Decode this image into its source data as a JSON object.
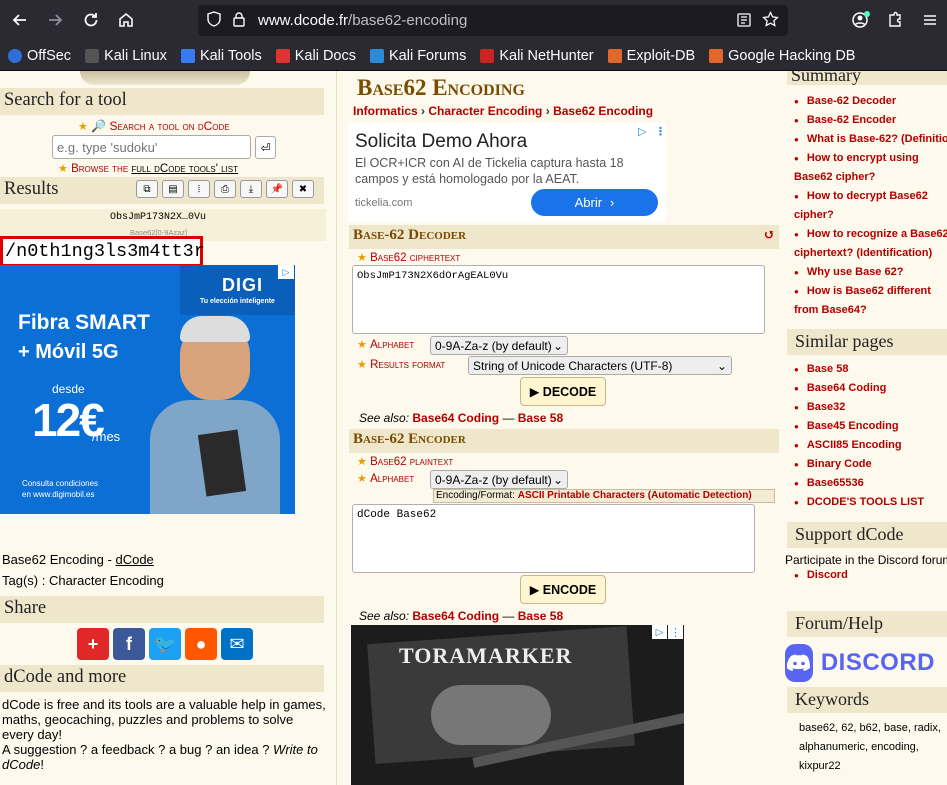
{
  "browser": {
    "url_host": "www.dcode.fr",
    "url_path": "/base62-encoding",
    "bookmarks": [
      "OffSec",
      "Kali Linux",
      "Kali Tools",
      "Kali Docs",
      "Kali Forums",
      "Kali NetHunter",
      "Exploit-DB",
      "Google Hacking DB"
    ]
  },
  "left": {
    "search_title": "Search for a tool",
    "search_link": "Search a tool on dCode",
    "search_placeholder": "e.g. type 'sudoku'",
    "browse_prefix": "Browse the ",
    "browse_link": "full dCode tools' list",
    "results_title": "Results",
    "result_preview": "ObsJmP173N2X…0Vu",
    "result_label": "Base62[0-9Azaz]",
    "result_value": "/n0th1ng3ls3m4tt3r",
    "ad_brand": "DIGI",
    "ad_tagline": "Tu elección inteligente",
    "ad_line1": "Fibra SMART",
    "ad_line2": "+ Móvil 5G",
    "ad_desde": "desde",
    "ad_price": "12€",
    "ad_per": "/mes",
    "ad_footer1": "Consulta condiciones",
    "ad_footer2": "en www.digimobil.es",
    "page_name": "Base62 Encoding - ",
    "page_name_link": "dCode",
    "tags": "Tag(s) : Character Encoding",
    "share_title": "Share",
    "more_title": "dCode and more",
    "more_text": "dCode is free and its tools are a valuable help in games, maths, geocaching, puzzles and problems to solve every day!",
    "suggest_text": "A suggestion ? a feedback ? a bug ? an idea ? ",
    "suggest_link": "Write to dCode",
    "suggest_end": "!"
  },
  "center": {
    "title": "Base62 Encoding",
    "breadcrumb": [
      "Informatics",
      "Character Encoding",
      "Base62 Encoding"
    ],
    "ad_title": "Solicita Demo Ahora",
    "ad_text": "El OCR+ICR con AI de Tickelia captura hasta 18 campos y está homologado por la AEAT.",
    "ad_domain": "tickelia.com",
    "ad_button": "Abrir",
    "decoder_title": "Base-62 Decoder",
    "decoder_label": "Base62 ciphertext",
    "decoder_value": "ObsJmP173N2X6dOrAgEAL0Vu",
    "alphabet_label": "Alphabet",
    "alphabet_value": "0-9A-Za-z (by default)",
    "format_label": "Results format",
    "format_value": "String of Unicode Characters (UTF-8)",
    "decode_button": "▶ DECODE",
    "see_also": "See also: ",
    "see_also_1": "Base64 Coding",
    "see_also_sep": " — ",
    "see_also_2": "Base 58",
    "encoder_title": "Base-62 Encoder",
    "encoder_label": "Base62 plaintext",
    "encoder_alphabet_value": "0-9A-Za-z (by default)",
    "encoding_format_prefix": "Encoding/Format: ",
    "encoding_format_value": "ASCII Printable Characters (Automatic Detection)",
    "encoder_value": "dCode Base62",
    "encode_button": "▶ ENCODE"
  },
  "right": {
    "summary_title": "Summary",
    "summary_items": [
      "Base-62 Decoder",
      "Base-62 Encoder",
      "What is Base-62? (Definition)",
      "How to encrypt using Base62 cipher?",
      "How to decrypt Base62 cipher?",
      "How to recognize a Base62 ciphertext? (Identification)",
      "Why use Base 62?",
      "How is Base62 different from Base64?"
    ],
    "similar_title": "Similar pages",
    "similar_items": [
      "Base 58",
      "Base64 Coding",
      "Base32",
      "Base45 Encoding",
      "ASCII85 Encoding",
      "Binary Code",
      "Base65536",
      "DCODE'S TOOLS LIST"
    ],
    "support_title": "Support dCode",
    "support_text": "Participate in the Discord forum",
    "support_link": "Discord",
    "forum_title": "Forum/Help",
    "discord_logo": "DISCORD",
    "keywords_title": "Keywords",
    "keywords": "base62, 62, b62, base, radix, alphanumeric, encoding, kixpur22"
  },
  "colors": {
    "accent": "#b30000",
    "section_bg": "#efe7cc",
    "page_bg": "#fdf9ec",
    "chrome": "#2b2a33"
  }
}
